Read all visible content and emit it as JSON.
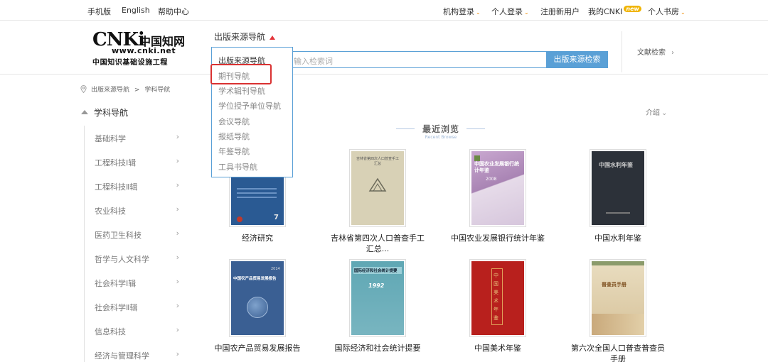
{
  "topbar": {
    "mobile": "手机版",
    "english": "English",
    "help": "帮助中心",
    "org_login": "机构登录",
    "personal_login": "个人登录",
    "register": "注册新用户",
    "my_cnki": "我的CNKI",
    "new_badge": "new",
    "study": "个人书房"
  },
  "logo": {
    "mark": "CNKi",
    "cn": "中国知网",
    "url": "www.cnki.net",
    "slogan": "中国知识基础设施工程"
  },
  "header": {
    "nav_select": "出版来源导航",
    "search_placeholder": "输入检索词",
    "search_button": "出版来源检索",
    "literature_search": "文献检索"
  },
  "dropdown": {
    "items": [
      "出版来源导航",
      "期刊导航",
      "学术辑刊导航",
      "学位授予单位导航",
      "会议导航",
      "报纸导航",
      "年鉴导航",
      "工具书导航"
    ]
  },
  "breadcrumb": {
    "root": "出版来源导航",
    "sep": ">",
    "current": "学科导航"
  },
  "sidebar": {
    "title": "学科导航",
    "items": [
      "基础科学",
      "工程科技Ⅰ辑",
      "工程科技Ⅱ辑",
      "农业科技",
      "医药卫生科技",
      "哲学与人文科学",
      "社会科学Ⅰ辑",
      "社会科学Ⅱ辑",
      "信息科技",
      "经济与管理科学"
    ]
  },
  "main": {
    "intro": "介绍",
    "recent_title": "最近浏览",
    "recent_sub": "Recent Browse",
    "books": [
      {
        "title": "经济研究",
        "cover_text": ""
      },
      {
        "title": "吉林省第四次人口普查手工汇总...",
        "cover_text": "吉林省第四次人口普查手工汇总"
      },
      {
        "title": "中国农业发展银行统计年鉴",
        "cover_text": "中国农业发展银行统计年鉴",
        "cover_year": "2008"
      },
      {
        "title": "中国水利年鉴",
        "cover_text": "中国水利年鉴"
      },
      {
        "title": "中国农产品贸易发展报告",
        "cover_text": "中国农产品贸易发展报告",
        "cover_year": "2014"
      },
      {
        "title": "国际经济和社会统计提要",
        "cover_text": "国际经济和社会统计提要",
        "cover_year": "1992"
      },
      {
        "title": "中国美术年鉴",
        "cover_text": "中国美术年鉴"
      },
      {
        "title": "第六次全国人口普查普查员手册",
        "cover_text": "普查员手册"
      }
    ]
  },
  "colors": {
    "accent_blue": "#5aa0d6",
    "highlight_red": "#d93131",
    "badge_orange": "#f0b400"
  }
}
